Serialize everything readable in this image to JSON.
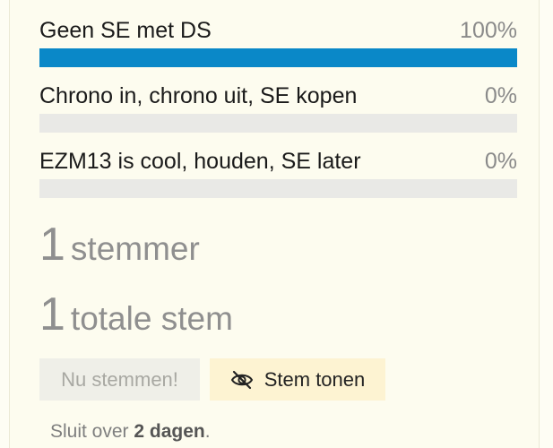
{
  "poll": {
    "options": [
      {
        "label": "Geen SE met DS",
        "percent_label": "100%",
        "percent": 100
      },
      {
        "label": "Chrono in, chrono uit, SE kopen",
        "percent_label": "0%",
        "percent": 0
      },
      {
        "label": "EZM13 is cool, houden, SE later",
        "percent_label": "0%",
        "percent": 0
      }
    ],
    "voters": {
      "count": "1",
      "label": "stemmer"
    },
    "total_votes": {
      "count": "1",
      "label": "totale stem"
    },
    "vote_button_label": "Nu stemmen!",
    "show_votes_button_label": "Stem tonen",
    "show_votes_icon": "eye-off-icon",
    "closes": {
      "prefix": "Sluit over",
      "duration": "2 dagen",
      "suffix": "."
    }
  },
  "colors": {
    "bar_fill": "#0a88c8",
    "bar_track": "#e9e9e6",
    "background": "#fdfcef",
    "show_votes_button_bg": "#fdf3d2"
  }
}
